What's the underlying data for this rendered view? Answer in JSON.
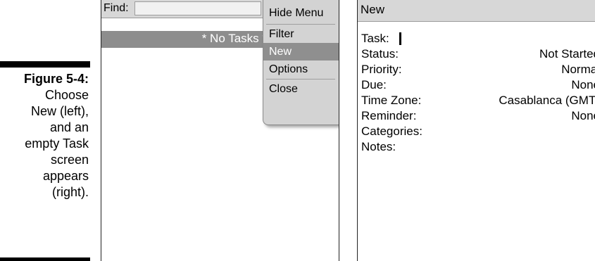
{
  "caption": {
    "figure_label": "Figure 5-4:",
    "lines": [
      "Choose",
      "New (left),",
      "and an",
      "empty Task",
      "screen",
      "appears",
      "(right)."
    ]
  },
  "left_screen": {
    "find_label": "Find:",
    "find_value": "",
    "empty_message": "* No Tasks *",
    "menu": {
      "items": [
        {
          "label": "Hide Menu",
          "selected": false
        },
        {
          "label": "Filter",
          "selected": false
        },
        {
          "label": "New",
          "selected": true
        },
        {
          "label": "Options",
          "selected": false
        },
        {
          "label": "Close",
          "selected": false
        }
      ]
    }
  },
  "right_screen": {
    "title": "New",
    "fields": [
      {
        "label": "Task:",
        "value": ""
      },
      {
        "label": "Status:",
        "value": "Not Started"
      },
      {
        "label": "Priority:",
        "value": "Normal"
      },
      {
        "label": "Due:",
        "value": "None"
      },
      {
        "label": "Time Zone:",
        "value": "Casablanca (GMT)"
      },
      {
        "label": "Reminder:",
        "value": "None"
      },
      {
        "label": "Categories:",
        "value": ""
      },
      {
        "label": "Notes:",
        "value": ""
      }
    ]
  },
  "colors": {
    "bar_gray": "#d7d7d7",
    "selection_gray": "#8f8f8f",
    "text": "#000000"
  }
}
